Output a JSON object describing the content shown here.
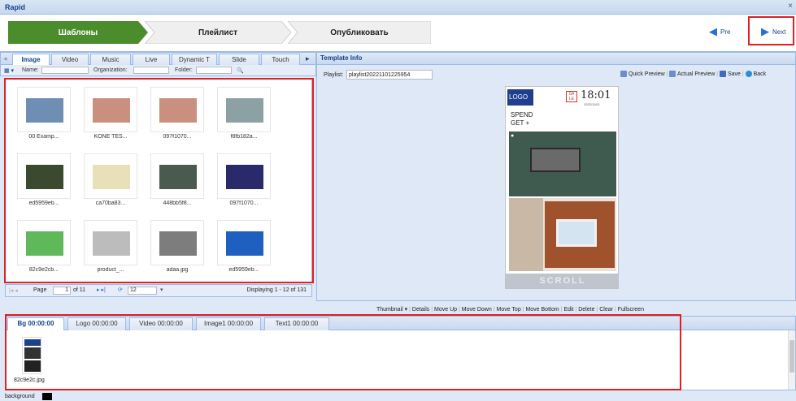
{
  "app": {
    "title": "Rapid",
    "close": "×"
  },
  "wizard": {
    "steps": [
      "Шаблоны",
      "Плейлист",
      "Опубликовать"
    ],
    "prev_label": "Pre",
    "next_label": "Next"
  },
  "library": {
    "tabs": [
      "Image",
      "Video",
      "Music",
      "Live",
      "Dynamic T",
      "Slide",
      "Touch"
    ],
    "active_tab": "Image",
    "filters": {
      "name_label": "Name:",
      "org_label": "Organization:",
      "folder_label": "Folder:"
    },
    "items": [
      "00 Examp...",
      "KONE TES...",
      "097f1070...",
      "f8fb182a...",
      "ed5959eb...",
      "ca70ba83...",
      "448bb5f8...",
      "097f1070...",
      "82c9e2cb...",
      "product_...",
      "adaa.jpg",
      "ed5959eb..."
    ],
    "pager": {
      "page_label": "Page",
      "page_value": "1",
      "of_label": "of 11",
      "page_size": "12",
      "display": "Displaying 1 - 12 of 131"
    }
  },
  "template_info": {
    "title": "Template Info",
    "playlist_label": "Playlist:",
    "playlist_value": "playlist20221101225954",
    "actions": [
      "Quick Preview",
      "Actual Preview",
      "Save",
      "Back"
    ]
  },
  "preview": {
    "logo": "LOGO",
    "sale": "SA LE",
    "time": "18:01",
    "date": "2022/11/01",
    "text1": "SPEND",
    "text2": "GET +",
    "scroll": "SCROLL"
  },
  "timeline_toolbar": [
    "Thumbnail ▾",
    "Details",
    "Move Up",
    "Move Down",
    "Move Top",
    "Move Bottom",
    "Edit",
    "Delete",
    "Clear",
    "Fullscreen"
  ],
  "timeline": {
    "tabs": [
      "Bg  00:00:00",
      "Logo 00:00:00",
      "Video 00:00:00",
      "Image1 00:00:00",
      "Text1 00:00:00"
    ],
    "items": [
      "82c9e2c.jpg"
    ]
  },
  "status": {
    "label": "background"
  },
  "colors": {
    "accent": "#15428b",
    "active_step": "#4b8d2c",
    "highlight": "#e02020"
  }
}
